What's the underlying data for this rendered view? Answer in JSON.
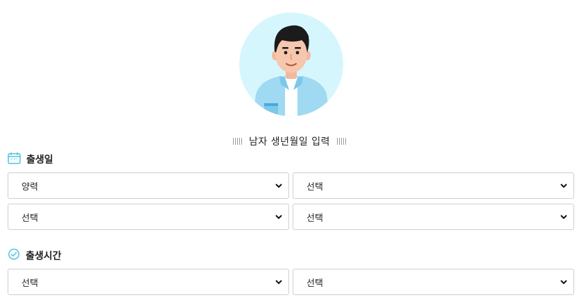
{
  "banner": {
    "title": "남자 생년월일 입력"
  },
  "birthday": {
    "label": "출생일",
    "icon": "calendar-icon",
    "selects": {
      "calendar_type": "양력",
      "year": "선택",
      "month": "선택",
      "day": "선택"
    }
  },
  "birthtime": {
    "label": "출생시간",
    "icon": "clock-icon",
    "selects": {
      "hour": "선택",
      "minute": "선택"
    }
  },
  "colors": {
    "accent": "#4fc3e0",
    "avatar_bg": "#d6f6fd",
    "border": "#cfcfcf"
  }
}
